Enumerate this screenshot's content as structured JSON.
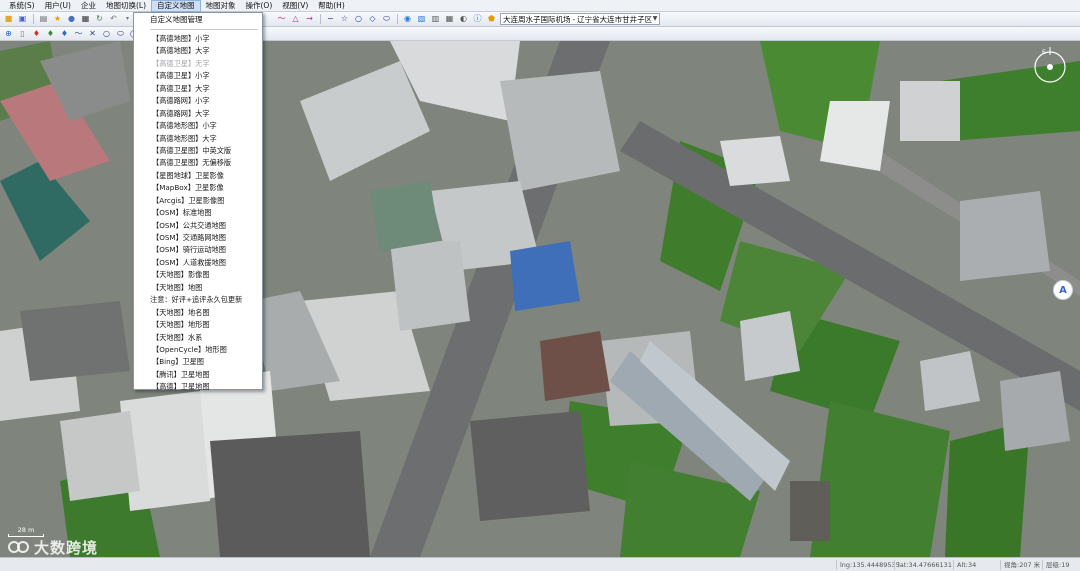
{
  "menubar": {
    "items": [
      {
        "label": "系统(S)"
      },
      {
        "label": "用户(U)"
      },
      {
        "label": "企业"
      },
      {
        "label": "地图切换(L)"
      },
      {
        "label": "自定义地图"
      },
      {
        "label": "地图对象"
      },
      {
        "label": "操作(O)"
      },
      {
        "label": "视图(V)"
      },
      {
        "label": "帮助(H)"
      }
    ],
    "active_index": 4
  },
  "toolbar": {
    "location_value": "大连周水子国际机场 - 辽宁省大连市甘井子区"
  },
  "custom_map_menu": {
    "header": "自定义地图管理",
    "items": [
      {
        "label": "【高德地图】小字",
        "enabled": true
      },
      {
        "label": "【高德地图】大字",
        "enabled": true
      },
      {
        "label": "【高德卫星】无字",
        "enabled": false
      },
      {
        "label": "【高德卫星】小字",
        "enabled": true
      },
      {
        "label": "【高德卫星】大字",
        "enabled": true
      },
      {
        "label": "【高德路网】小字",
        "enabled": true
      },
      {
        "label": "【高德路网】大字",
        "enabled": true
      },
      {
        "label": "【高德地形图】小字",
        "enabled": true
      },
      {
        "label": "【高德地形图】大字",
        "enabled": true
      },
      {
        "label": "【高德卫星图】中英文版",
        "enabled": true
      },
      {
        "label": "【高德卫星图】无偏移版",
        "enabled": true
      },
      {
        "label": "【星图地球】卫星影像",
        "enabled": true
      },
      {
        "label": "【MapBox】卫星影像",
        "enabled": true
      },
      {
        "label": "【Arcgis】卫星影像图",
        "enabled": true
      },
      {
        "label": "【OSM】标准地图",
        "enabled": true
      },
      {
        "label": "【OSM】公共交通地图",
        "enabled": true
      },
      {
        "label": "【OSM】交通路网地图",
        "enabled": true
      },
      {
        "label": "【OSM】骑行运动地图",
        "enabled": true
      },
      {
        "label": "【OSM】人道救援地图",
        "enabled": true
      },
      {
        "label": "【天地图】影像图",
        "enabled": true
      },
      {
        "label": "【天地图】地图",
        "enabled": true
      },
      {
        "label": "注意：好评+追评永久包更新",
        "enabled": true,
        "notice": true
      },
      {
        "label": "【天地图】地名图",
        "enabled": true
      },
      {
        "label": "【天地图】地形图",
        "enabled": true
      },
      {
        "label": "【天地图】水系",
        "enabled": true
      },
      {
        "label": "【OpenCycle】地形图",
        "enabled": true
      },
      {
        "label": "【Bing】卫星图",
        "enabled": true
      },
      {
        "label": "【腾讯】卫星地图",
        "enabled": true
      },
      {
        "label": "【高德】卫星地图",
        "enabled": true
      }
    ]
  },
  "map": {
    "scale_label": "28 m",
    "compass_label": "E"
  },
  "statusbar": {
    "lng": "lng:135.44489535",
    "lat": "lat:34.47666131",
    "alt": "Alt:34",
    "view_alt": "视角:207 米",
    "level": "层级:19"
  },
  "watermark": "大数跨境",
  "colors": {
    "menubar_bg": "#eef1f6",
    "accent": "#3b63d6",
    "field_green": "#3f7d2c",
    "road_gray": "#6d6e6f"
  }
}
